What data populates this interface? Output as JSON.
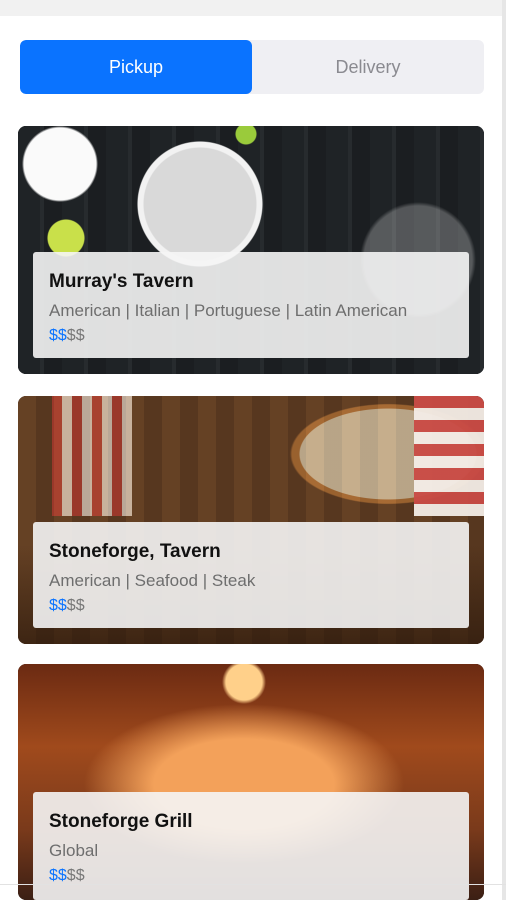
{
  "tabs": {
    "pickup_label": "Pickup",
    "delivery_label": "Delivery",
    "active": "pickup"
  },
  "colors": {
    "accent": "#0a73ff",
    "price_active": "#0a73ff",
    "price_inactive": "#777777"
  },
  "restaurants": [
    {
      "name": "Murray's Tavern",
      "cuisine": "American | Italian | Portuguese | Latin American",
      "price_active": "$$",
      "price_inactive": "$$"
    },
    {
      "name": "Stoneforge, Tavern",
      "cuisine": "American | Seafood | Steak",
      "price_active": "$$",
      "price_inactive": "$$"
    },
    {
      "name": "Stoneforge Grill",
      "cuisine": "Global",
      "price_active": "$$",
      "price_inactive": "$$"
    }
  ]
}
